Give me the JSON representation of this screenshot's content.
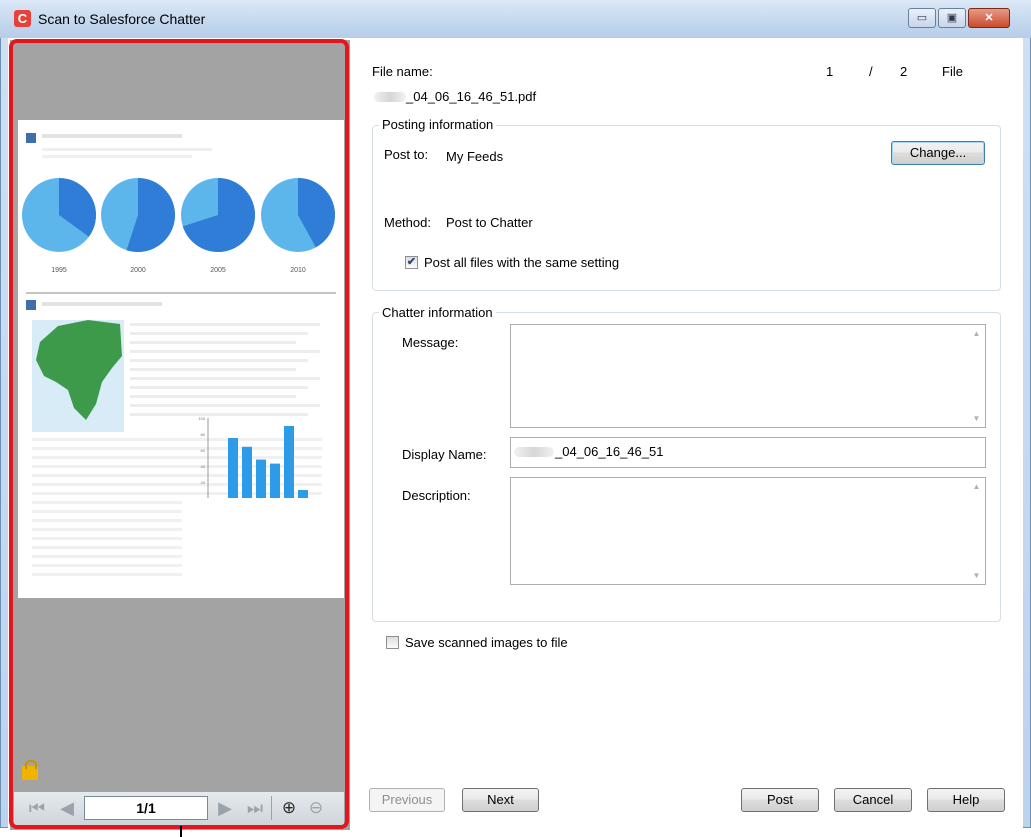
{
  "window": {
    "title": "Scan to Salesforce Chatter",
    "app_icon_text": "C",
    "minimize_glyph": "▭",
    "maximize_glyph": "▣",
    "close_glyph": "✕"
  },
  "preview": {
    "pie_years": [
      "1995",
      "2000",
      "2005",
      "2010"
    ],
    "pie_colors": [
      "#5cb6ec",
      "#2f7dd6"
    ],
    "bar_color": "#2e9be8",
    "bar_levels": [
      0.75,
      0.64,
      0.48,
      0.43,
      0.9,
      0.1
    ],
    "bar_axis_ticks": [
      "100",
      "80",
      "60",
      "40",
      "20"
    ],
    "nav": {
      "first_icon": "first-page-icon",
      "prev_icon": "previous-page-icon",
      "page_value": "1/1",
      "next_icon": "next-page-icon",
      "last_icon": "last-page-icon",
      "zoom_in_icon": "zoom-in-icon",
      "zoom_out_icon": "zoom-out-icon"
    }
  },
  "file": {
    "label": "File name:",
    "name": "_04_06_16_46_51.pdf",
    "index": "1",
    "separator": "/",
    "total": "2",
    "unit": "File"
  },
  "posting": {
    "title": "Posting information",
    "post_to_label": "Post to:",
    "post_to_value": "My Feeds",
    "change_button": "Change...",
    "method_label": "Method:",
    "method_value": "Post to Chatter",
    "same_setting_label": "Post all files with the same setting",
    "same_setting_checked": true
  },
  "chatter": {
    "title": "Chatter information",
    "message_label": "Message:",
    "message_value": "",
    "display_name_label": "Display Name:",
    "display_name_value": "_04_06_16_46_51",
    "description_label": "Description:",
    "description_value": ""
  },
  "save_images": {
    "label": "Save scanned images to file",
    "checked": false
  },
  "buttons": {
    "previous": "Previous",
    "next": "Next",
    "post": "Post",
    "cancel": "Cancel",
    "help": "Help"
  }
}
